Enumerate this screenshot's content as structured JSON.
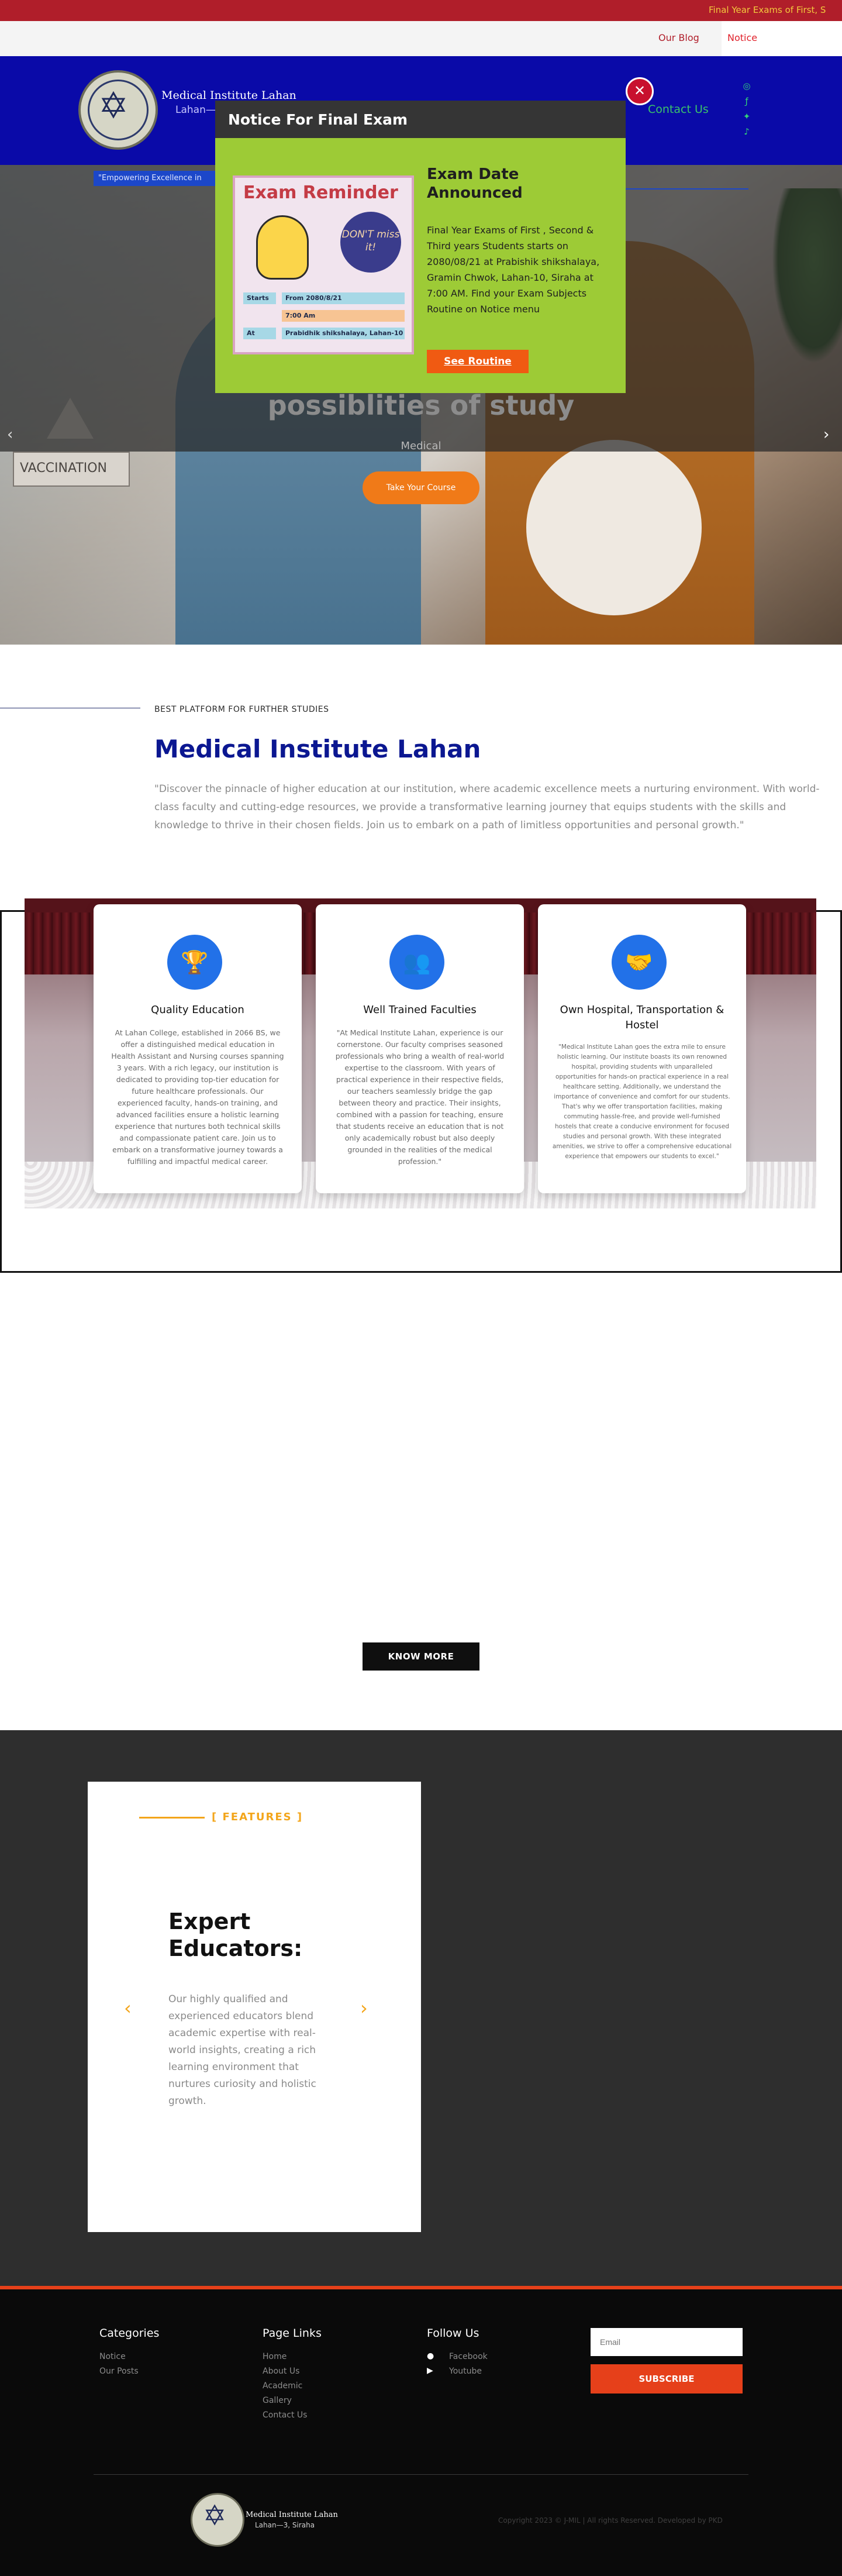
{
  "ticker": {
    "text": "Final Year Exams of First, S"
  },
  "topbar": {
    "blog_label": "Our Blog",
    "notice_label": "Notice"
  },
  "brand": {
    "name": "Medical Institute Lahan",
    "location": "Lahan—"
  },
  "nav": {
    "contact_label": "Contact Us"
  },
  "social": {
    "icons": [
      "instagram-icon",
      "facebook-icon",
      "twitter-icon",
      "tiktok-icon"
    ]
  },
  "hero": {
    "tagline": "\"Empowering Excellence in",
    "heading": "possiblities of study",
    "subheading": "Medical",
    "cta_label": "Take Your Course",
    "prev_icon": "chevron-left-icon",
    "next_icon": "chevron-right-icon",
    "sign_text": "VACCINATION"
  },
  "about": {
    "eyebrow": "BEST PLATFORM FOR FURTHER STUDIES",
    "title": "Medical Institute Lahan",
    "text": "\"Discover the pinnacle of higher education at our institution, where academic excellence meets a nurturing environment. With world-class faculty and cutting-edge resources, we provide a transformative learning journey that equips students with the skills and knowledge to thrive in their chosen fields. Join us to embark on a path of limitless opportunities and personal growth.\""
  },
  "features": [
    {
      "icon": "trophy-icon",
      "title": "Quality Education",
      "text": "At Lahan College, established in 2066 BS, we offer a distinguished medical education in Health Assistant and Nursing courses spanning 3 years. With a rich legacy, our institution is dedicated to providing top-tier education for future healthcare professionals. Our experienced faculty, hands-on training, and advanced facilities ensure a holistic learning experience that nurtures both technical skills and compassionate patient care. Join us to embark on a transformative journey towards a fulfilling and impactful medical career."
    },
    {
      "icon": "team-icon",
      "title": "Well Trained Faculties",
      "text": "\"At Medical Institute Lahan, experience is our cornerstone. Our faculty comprises seasoned professionals who bring a wealth of real-world expertise to the classroom. With years of practical experience in their respective fields, our teachers seamlessly bridge the gap between theory and practice. Their insights, combined with a passion for teaching, ensure that students receive an education that is not only academically robust but also deeply grounded in the realities of the medical profession.\""
    },
    {
      "icon": "handshake-icon",
      "title": "Own Hospital, Transportation & Hostel",
      "text": "\"Medical Institute Lahan goes the extra mile to ensure holistic learning. Our institute boasts its own renowned hospital, providing students with unparalleled opportunities for hands-on practical experience in a real healthcare setting. Additionally, we understand the importance of convenience and comfort for our students. That's why we offer transportation facilities, making commuting hassle-free, and provide well-furnished hostels that create a conducive environment for focused studies and personal growth. With these integrated amenities, we strive to offer a comprehensive educational experience that empowers our students to excel.\""
    }
  ],
  "know_more_label": "KNOW MORE",
  "experts": {
    "tag": "[ FEATURES ]",
    "title": "Expert Educators:",
    "text": "Our highly qualified and experienced educators blend academic expertise with real-world insights, creating a rich learning environment that nurtures curiosity and holistic growth.",
    "prev_icon": "chevron-left-icon",
    "next_icon": "chevron-right-icon"
  },
  "footer": {
    "categories_heading": "Categories",
    "categories": [
      "Notice",
      "Our Posts"
    ],
    "pagelinks_heading": "Page Links",
    "pagelinks": [
      "Home",
      "About Us",
      "Academic",
      "Gallery",
      " Contact Us"
    ],
    "follow_heading": "Follow Us",
    "follow": [
      {
        "icon": "facebook-icon",
        "label": "Facebook"
      },
      {
        "icon": "youtube-icon",
        "label": "Youtube"
      }
    ],
    "email_placeholder": "Email",
    "subscribe_label": "SUBSCRIBE",
    "brand_name": "Medical Institute Lahan",
    "brand_location": "Lahan—3, Siraha",
    "copyright": "Copyright 2023 © J-MIL | All rights Reserved. Developed by PKD"
  },
  "modal": {
    "title": "Notice For Final Exam",
    "close_icon": "close-icon",
    "poster": {
      "heading": "Exam Reminder",
      "badge": "DON'T miss it!",
      "rows": [
        {
          "key": "Starts",
          "value": "From 2080/8/21"
        },
        {
          "key": "",
          "value": "7:00 Am"
        },
        {
          "key": "At",
          "value": "Prabidhik shikshalaya, Lahan-10"
        }
      ]
    },
    "heading": "Exam Date Announced",
    "text": "Final Year Exams of First , Second & Third years Students starts on 2080/08/21 at Prabishik shikshalaya, Gramin Chwok, Lahan-10, Siraha at 7:00 AM. Find your Exam Subjects Routine on Notice menu",
    "button_label": "See Routine"
  },
  "colors": {
    "header": "#0a0aa8",
    "accent": "#f07a18",
    "footer_accent": "#e6401a",
    "modal": "#9dcb36",
    "title_blue": "#0b1791"
  }
}
